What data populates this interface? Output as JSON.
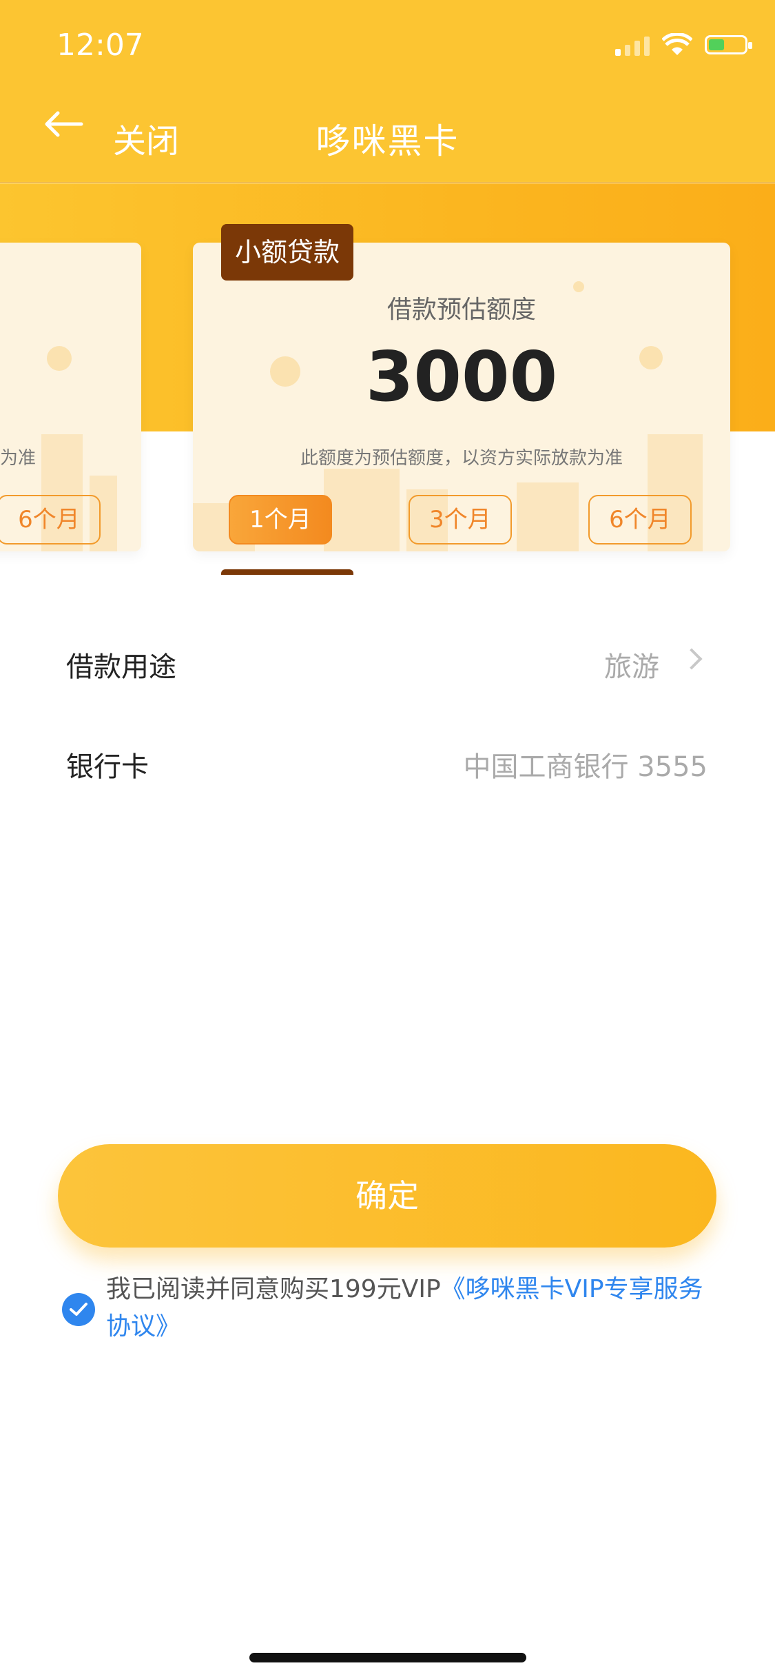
{
  "status": {
    "time": "12:07"
  },
  "nav": {
    "close_label": "关闭",
    "title": "哆咪黑卡"
  },
  "card": {
    "tag": "小额贷款",
    "amount_label": "借款预估额度",
    "amount": "3000",
    "note": "此额度为预估额度，以资方实际放款为准",
    "left_note": "为准",
    "left_period": "6个月",
    "periods": [
      "1个月",
      "3个月",
      "6个月"
    ],
    "selected_period": "1个月"
  },
  "form": {
    "purpose_label": "借款用途",
    "purpose_value": "旅游",
    "bank_label": "银行卡",
    "bank_value": "中国工商银行 3555"
  },
  "confirm_label": "确定",
  "agreement": {
    "text": "我已阅读并同意购买199元VIP",
    "link": "《哆咪黑卡VIP专享服务协议》"
  },
  "colors": {
    "primary": "#fcc532",
    "accent": "#f0862a",
    "link": "#2f86ee",
    "tag": "#7b3807"
  }
}
